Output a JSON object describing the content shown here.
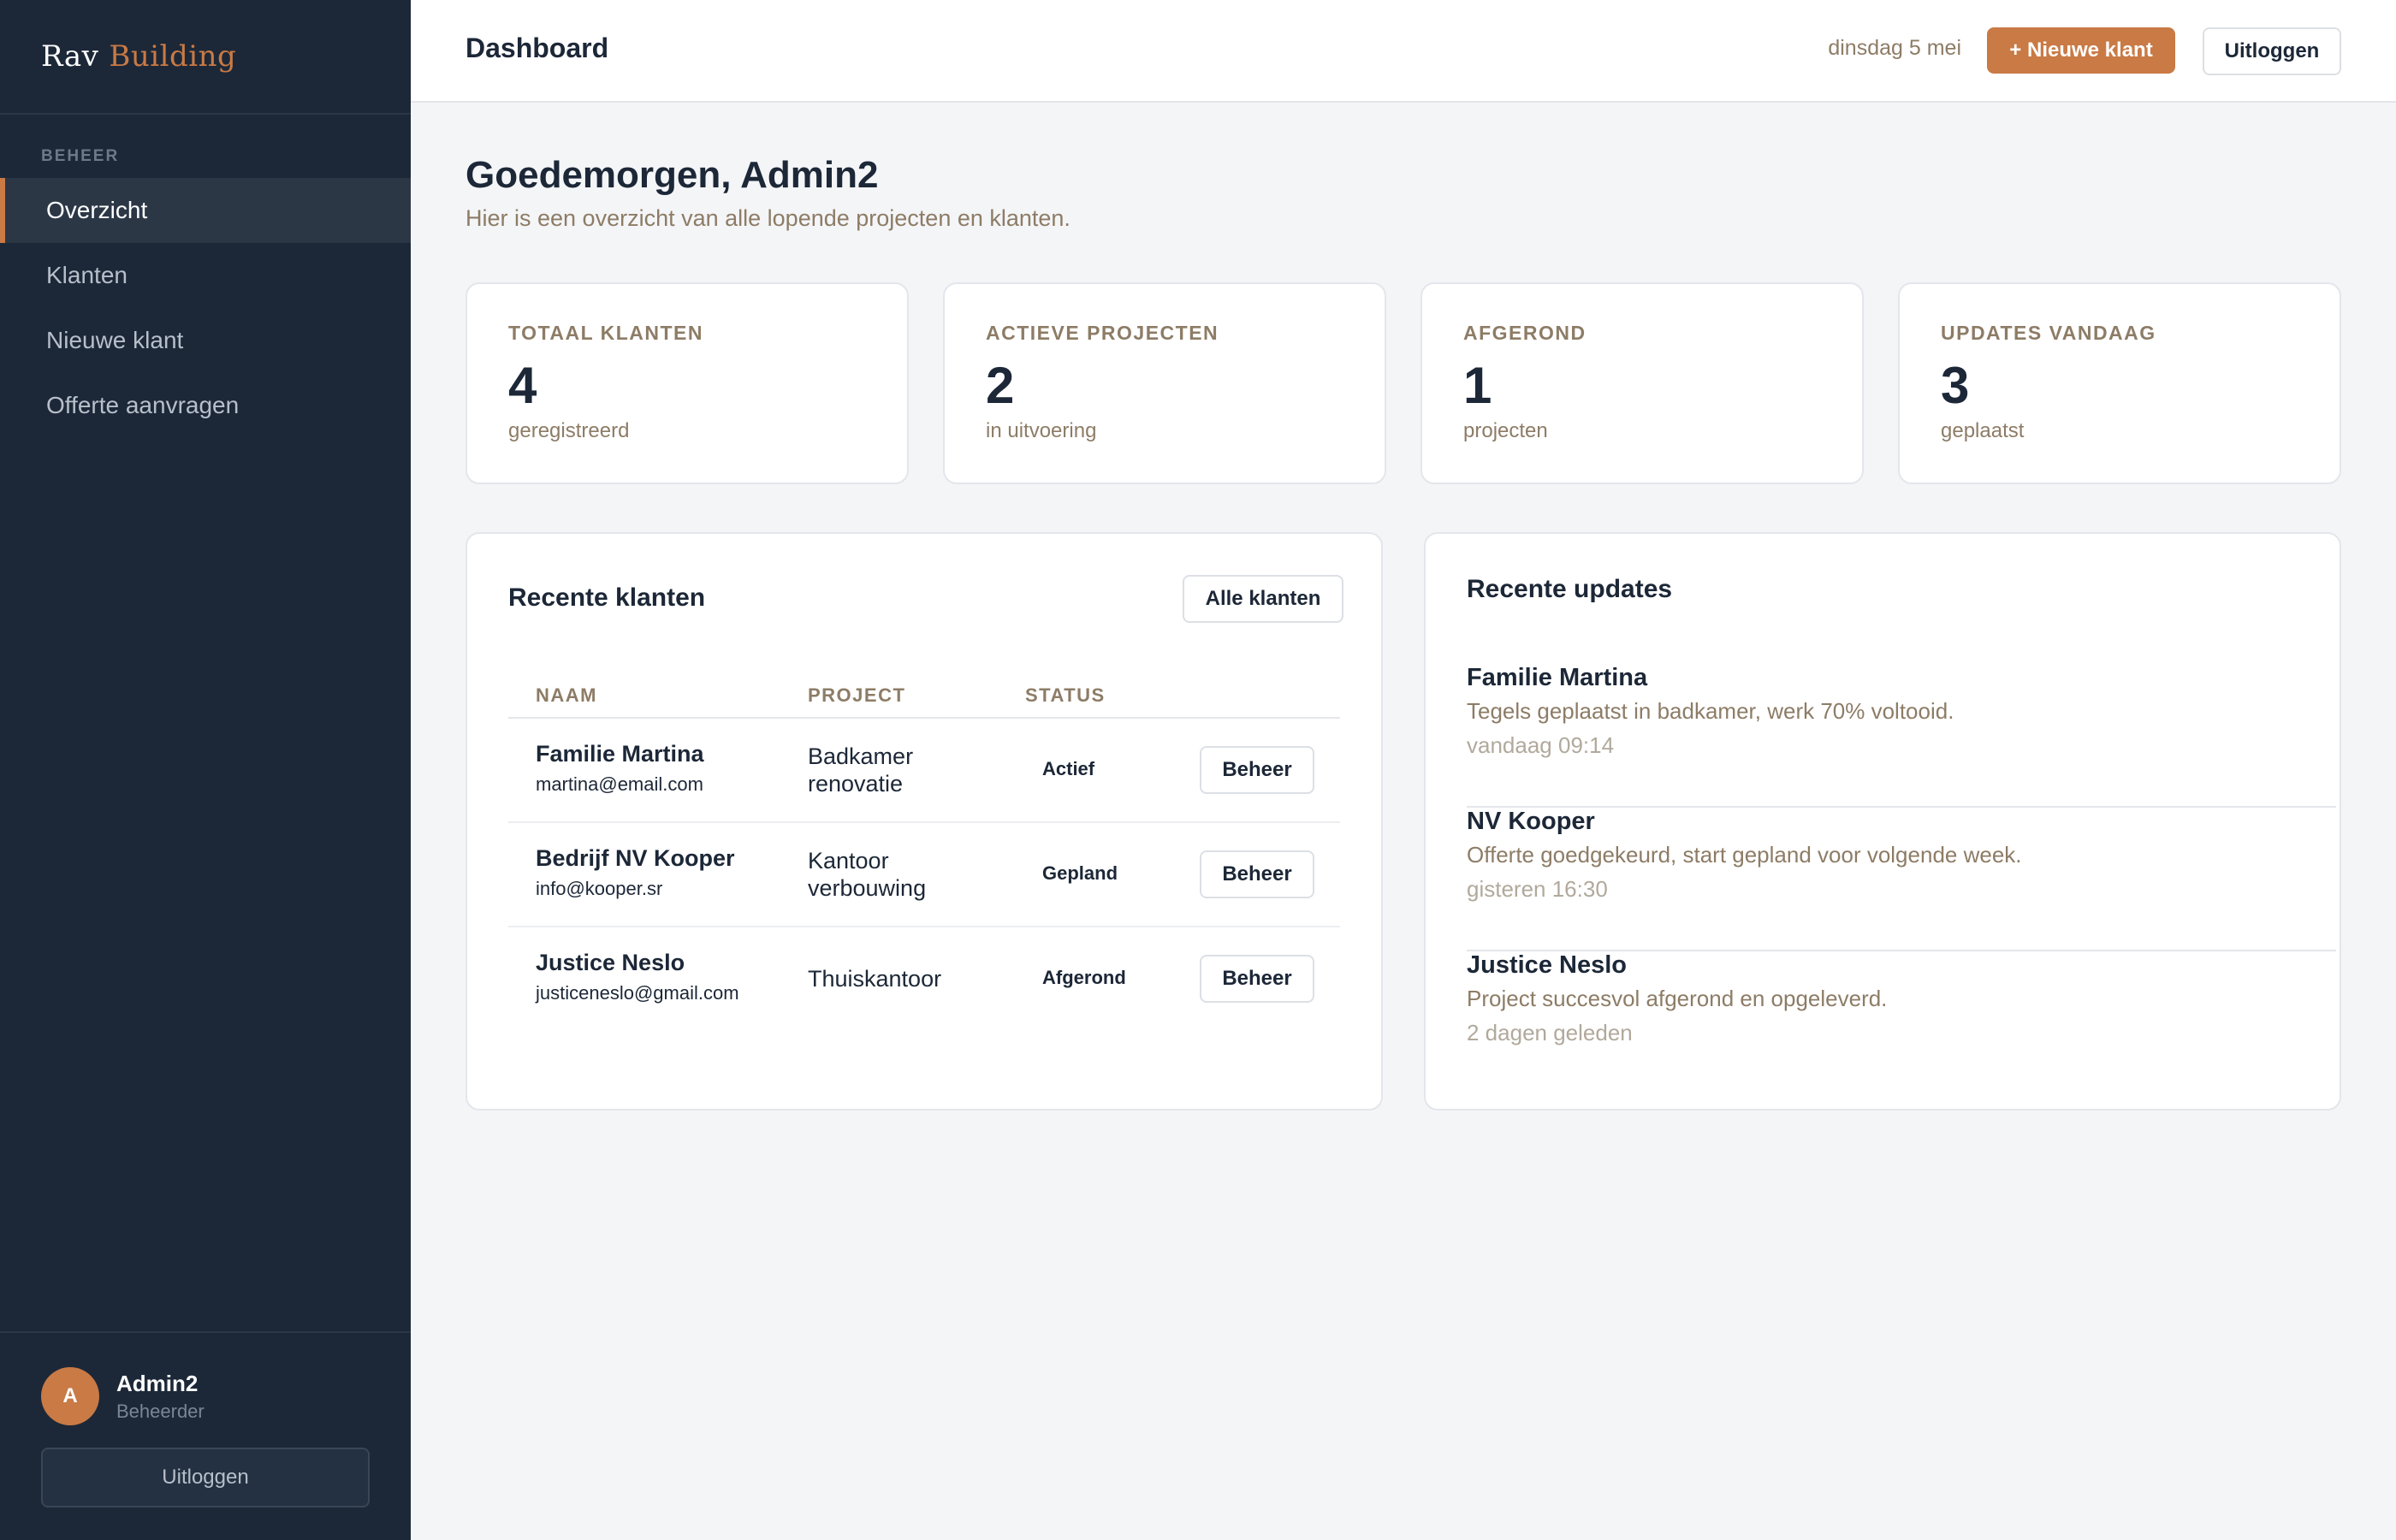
{
  "sidebar": {
    "brand_part1": "Rav",
    "brand_part2": "Building",
    "section_label": "BEHEER",
    "items": [
      {
        "label": "Overzicht",
        "active": true
      },
      {
        "label": "Klanten"
      },
      {
        "label": "Nieuwe klant"
      },
      {
        "label": "Offerte aanvragen"
      }
    ],
    "user": {
      "initial": "A",
      "name": "Admin2",
      "role": "Beheerder"
    },
    "logout_label": "Uitloggen"
  },
  "header": {
    "title": "Dashboard",
    "date": "dinsdag 5 mei",
    "new_client_label": "+ Nieuwe klant",
    "logout_label": "Uitloggen"
  },
  "main": {
    "greeting": "Goedemorgen, Admin2",
    "subtitle": "Hier is een overzicht van alle lopende projecten en klanten.",
    "stats": [
      {
        "label": "TOTAAL KLANTEN",
        "value": "4",
        "sub": "geregistreerd"
      },
      {
        "label": "ACTIEVE PROJECTEN",
        "value": "2",
        "sub": "in uitvoering"
      },
      {
        "label": "AFGEROND",
        "value": "1",
        "sub": "projecten"
      },
      {
        "label": "UPDATES VANDAAG",
        "value": "3",
        "sub": "geplaatst"
      }
    ],
    "recent_clients": {
      "title": "Recente klanten",
      "all_label": "Alle klanten",
      "columns": [
        "NAAM",
        "PROJECT",
        "STATUS"
      ],
      "rows": [
        {
          "name": "Familie Martina",
          "email": "martina@email.com",
          "project_line1": "Badkamer",
          "project_line2": "renovatie",
          "status": "Actief",
          "action": "Beheer"
        },
        {
          "name": "Bedrijf NV Kooper",
          "email": "info@kooper.sr",
          "project_line1": "Kantoor",
          "project_line2": "verbouwing",
          "status": "Gepland",
          "action": "Beheer"
        },
        {
          "name": "Justice Neslo",
          "email": "justiceneslo@gmail.com",
          "project_line1": "Thuiskantoor",
          "project_line2": "",
          "status": "Afgerond",
          "action": "Beheer"
        }
      ]
    },
    "recent_updates": {
      "title": "Recente updates",
      "items": [
        {
          "name": "Familie Martina",
          "text": "Tegels geplaatst in badkamer, werk 70% voltooid.",
          "time": "vandaag 09:14"
        },
        {
          "name": "NV Kooper",
          "text": "Offerte goedgekeurd, start gepland voor volgende week.",
          "time": "gisteren 16:30"
        },
        {
          "name": "Justice Neslo",
          "text": "Project succesvol afgerond en opgeleverd.",
          "time": "2 dagen geleden"
        }
      ]
    }
  }
}
